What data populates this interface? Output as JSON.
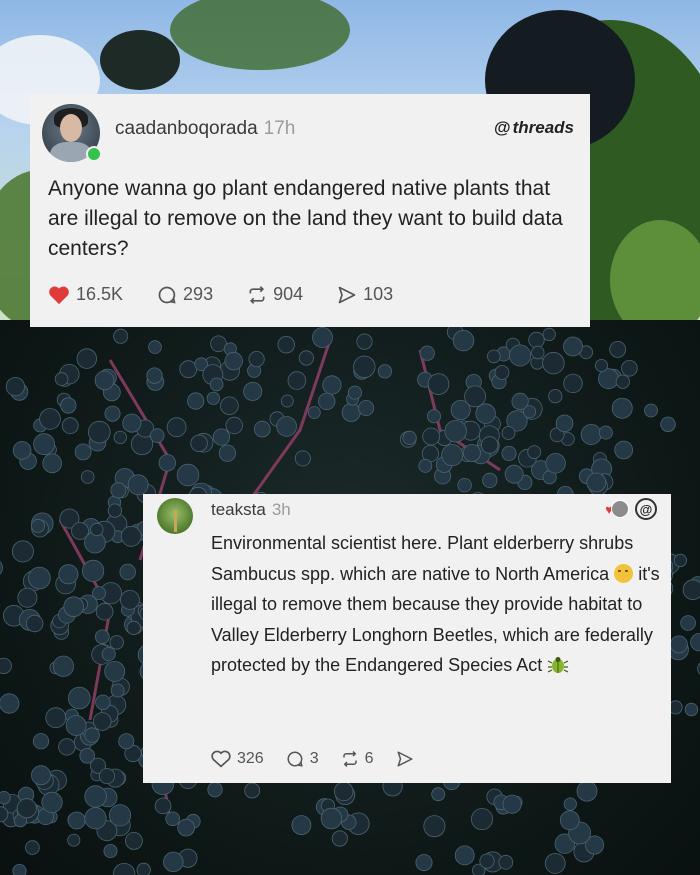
{
  "post": {
    "username": "caadanboqorada",
    "time": "17h",
    "brand": "threads",
    "text": "Anyone wanna go plant endangered native plants that are illegal to remove on the land they want to build data centers?",
    "likes": "16.5K",
    "comments": "293",
    "reposts": "904",
    "shares": "103",
    "like_color": "#e03a3a"
  },
  "reply": {
    "username": "teaksta",
    "time": "3h",
    "text_part1": "Environmental scientist here. Plant elderberry shrubs Sambucus spp. which are native to North America",
    "text_part2": "it's illegal to remove them because they provide habitat to Valley Elderberry Longhorn Beetles, which are federally protected by the Endangered Species Act",
    "likes": "326",
    "comments": "3",
    "reposts": "6"
  },
  "icons": {
    "like": "heart-icon",
    "comment": "comment-bubble-icon",
    "repost": "repost-icon",
    "share": "send-icon",
    "brand": "threads-logo-icon"
  }
}
